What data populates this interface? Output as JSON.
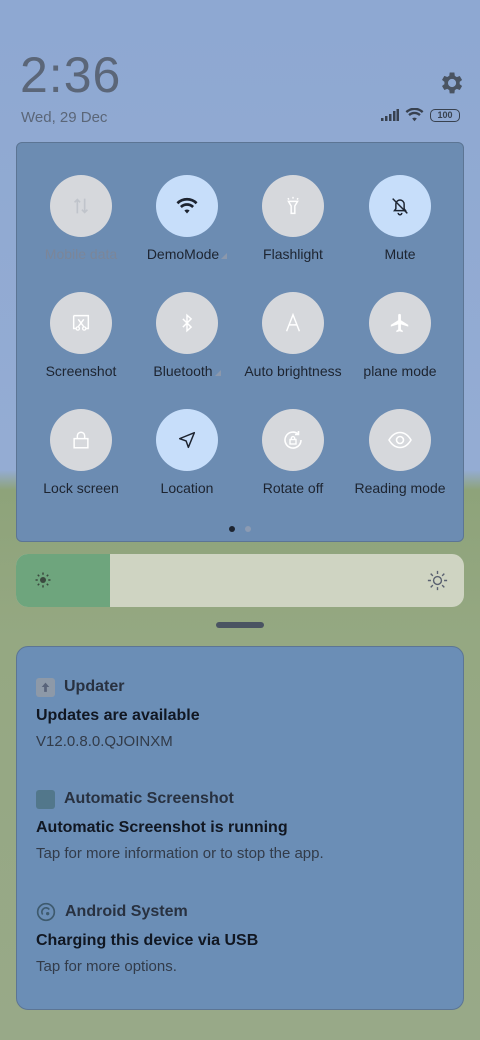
{
  "lockscreen": {
    "time": "2:36",
    "date": "Wed, 29 Dec",
    "battery": "100"
  },
  "quick_settings": {
    "tiles": [
      {
        "label": "Mobile data",
        "icon": "mobile-data-icon",
        "state": "disabled"
      },
      {
        "label": "DemoMode",
        "icon": "wifi-icon",
        "state": "on"
      },
      {
        "label": "Flashlight",
        "icon": "flashlight-icon",
        "state": "off"
      },
      {
        "label": "Mute",
        "icon": "mute-bell-icon",
        "state": "on"
      },
      {
        "label": "Screenshot",
        "icon": "screenshot-icon",
        "state": "off"
      },
      {
        "label": "Bluetooth",
        "icon": "bluetooth-icon",
        "state": "off"
      },
      {
        "label": "Auto brightness",
        "icon": "auto-brightness-icon",
        "state": "off"
      },
      {
        "label": "plane mode",
        "icon": "airplane-icon",
        "state": "off"
      },
      {
        "label": "Lock screen",
        "icon": "lock-icon",
        "state": "off"
      },
      {
        "label": "Location",
        "icon": "location-arrow-icon",
        "state": "on"
      },
      {
        "label": "Rotate off",
        "icon": "rotate-icon",
        "state": "off"
      },
      {
        "label": "Reading mode",
        "icon": "eye-icon",
        "state": "off"
      }
    ],
    "page_count": 2,
    "current_page": 1
  },
  "brightness": {
    "level_fraction": 0.21
  },
  "notifications": [
    {
      "app": "Updater",
      "title": "Updates are available",
      "body": "V12.0.8.0.QJOINXM",
      "icon": "updater-arrow-icon"
    },
    {
      "app": "Automatic Screenshot",
      "title": "Automatic Screenshot is running",
      "body": "Tap for more information or to stop the app.",
      "icon": "app-square-icon"
    },
    {
      "app": "Android System",
      "title": "Charging this device via USB",
      "body": "Tap for more options.",
      "icon": "android-system-icon"
    }
  ],
  "colors": {
    "tile_on": "#c7defa",
    "tile_off": "#d6d8dc",
    "panel": "#6c8cb2",
    "brightness_fill": "#6ea57d"
  }
}
